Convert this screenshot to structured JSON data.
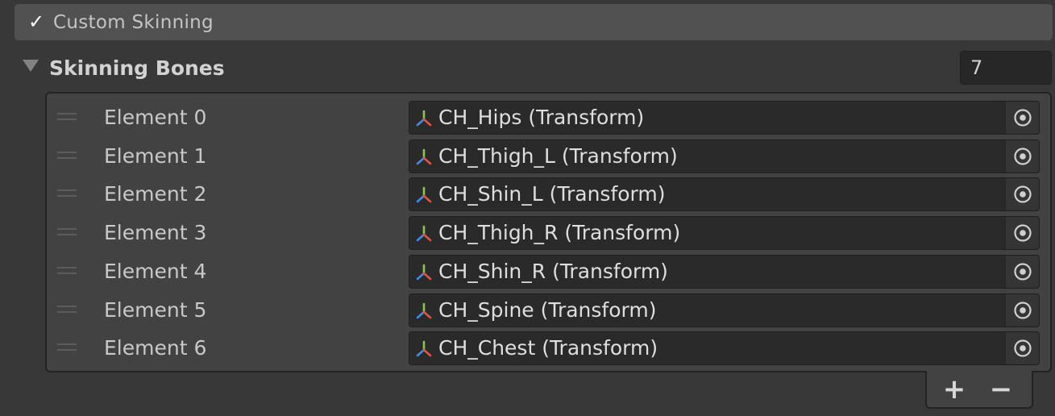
{
  "custom_skinning": {
    "label": "Custom Skinning",
    "checked": true,
    "check_glyph": "✓"
  },
  "skinning_bones": {
    "label": "Skinning Bones",
    "size": "7",
    "expanded": true,
    "elements": [
      {
        "label": "Element 0",
        "value": "CH_Hips (Transform)"
      },
      {
        "label": "Element 1",
        "value": "CH_Thigh_L (Transform)"
      },
      {
        "label": "Element 2",
        "value": "CH_Shin_L (Transform)"
      },
      {
        "label": "Element 3",
        "value": "CH_Thigh_R (Transform)"
      },
      {
        "label": "Element 4",
        "value": "CH_Shin_R (Transform)"
      },
      {
        "label": "Element 5",
        "value": "CH_Spine (Transform)"
      },
      {
        "label": "Element 6",
        "value": "CH_Chest (Transform)"
      }
    ]
  },
  "footer": {
    "add_label": "+",
    "remove_label": "−"
  },
  "icons": {
    "checkbox": "checkmark-icon",
    "foldout": "triangle-down-icon",
    "transform": "transform-axes-icon",
    "picker": "object-picker-icon",
    "drag": "drag-handle-icon"
  },
  "colors": {
    "background": "#383838",
    "header_bar": "#515151",
    "field_bg": "#2a2a2a",
    "axis_x": "#e0553c",
    "axis_y": "#8fc54a",
    "axis_z": "#3f8ee6"
  }
}
